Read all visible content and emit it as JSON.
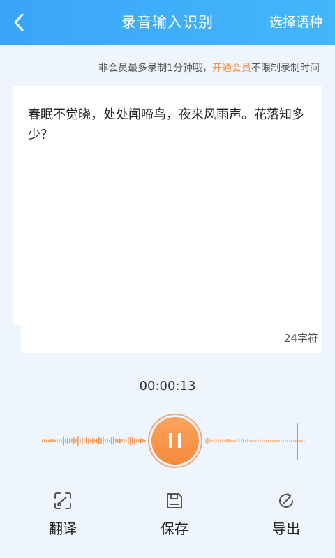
{
  "header": {
    "title": "录音输入识别",
    "language_button": "选择语种"
  },
  "notice": {
    "prefix": "非会员最多录制1分钟哦，",
    "link": "开通会员",
    "suffix": "不限制录制时间"
  },
  "transcript": {
    "text": "春眠不觉晓，处处闻啼鸟，夜来风雨声。花落知多少？",
    "char_count": "24字符"
  },
  "recorder": {
    "elapsed": "00:00:13"
  },
  "actions": {
    "translate": "翻译",
    "save": "保存",
    "export": "导出"
  },
  "colors": {
    "header": "#3aa5f9",
    "accent": "#f48a3c",
    "background": "#eef5fc"
  }
}
